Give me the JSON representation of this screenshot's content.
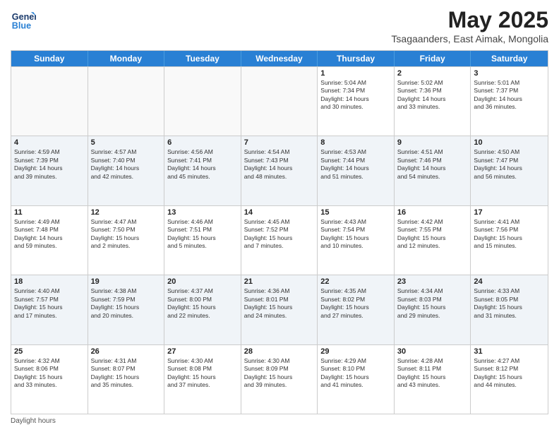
{
  "header": {
    "logo_general": "General",
    "logo_blue": "Blue",
    "month_title": "May 2025",
    "location": "Tsagaanders, East Aimak, Mongolia"
  },
  "days_of_week": [
    "Sunday",
    "Monday",
    "Tuesday",
    "Wednesday",
    "Thursday",
    "Friday",
    "Saturday"
  ],
  "footer": {
    "note": "Daylight hours"
  },
  "weeks": [
    [
      {
        "day": "",
        "info": ""
      },
      {
        "day": "",
        "info": ""
      },
      {
        "day": "",
        "info": ""
      },
      {
        "day": "",
        "info": ""
      },
      {
        "day": "1",
        "info": "Sunrise: 5:04 AM\nSunset: 7:34 PM\nDaylight: 14 hours\nand 30 minutes."
      },
      {
        "day": "2",
        "info": "Sunrise: 5:02 AM\nSunset: 7:36 PM\nDaylight: 14 hours\nand 33 minutes."
      },
      {
        "day": "3",
        "info": "Sunrise: 5:01 AM\nSunset: 7:37 PM\nDaylight: 14 hours\nand 36 minutes."
      }
    ],
    [
      {
        "day": "4",
        "info": "Sunrise: 4:59 AM\nSunset: 7:39 PM\nDaylight: 14 hours\nand 39 minutes."
      },
      {
        "day": "5",
        "info": "Sunrise: 4:57 AM\nSunset: 7:40 PM\nDaylight: 14 hours\nand 42 minutes."
      },
      {
        "day": "6",
        "info": "Sunrise: 4:56 AM\nSunset: 7:41 PM\nDaylight: 14 hours\nand 45 minutes."
      },
      {
        "day": "7",
        "info": "Sunrise: 4:54 AM\nSunset: 7:43 PM\nDaylight: 14 hours\nand 48 minutes."
      },
      {
        "day": "8",
        "info": "Sunrise: 4:53 AM\nSunset: 7:44 PM\nDaylight: 14 hours\nand 51 minutes."
      },
      {
        "day": "9",
        "info": "Sunrise: 4:51 AM\nSunset: 7:46 PM\nDaylight: 14 hours\nand 54 minutes."
      },
      {
        "day": "10",
        "info": "Sunrise: 4:50 AM\nSunset: 7:47 PM\nDaylight: 14 hours\nand 56 minutes."
      }
    ],
    [
      {
        "day": "11",
        "info": "Sunrise: 4:49 AM\nSunset: 7:48 PM\nDaylight: 14 hours\nand 59 minutes."
      },
      {
        "day": "12",
        "info": "Sunrise: 4:47 AM\nSunset: 7:50 PM\nDaylight: 15 hours\nand 2 minutes."
      },
      {
        "day": "13",
        "info": "Sunrise: 4:46 AM\nSunset: 7:51 PM\nDaylight: 15 hours\nand 5 minutes."
      },
      {
        "day": "14",
        "info": "Sunrise: 4:45 AM\nSunset: 7:52 PM\nDaylight: 15 hours\nand 7 minutes."
      },
      {
        "day": "15",
        "info": "Sunrise: 4:43 AM\nSunset: 7:54 PM\nDaylight: 15 hours\nand 10 minutes."
      },
      {
        "day": "16",
        "info": "Sunrise: 4:42 AM\nSunset: 7:55 PM\nDaylight: 15 hours\nand 12 minutes."
      },
      {
        "day": "17",
        "info": "Sunrise: 4:41 AM\nSunset: 7:56 PM\nDaylight: 15 hours\nand 15 minutes."
      }
    ],
    [
      {
        "day": "18",
        "info": "Sunrise: 4:40 AM\nSunset: 7:57 PM\nDaylight: 15 hours\nand 17 minutes."
      },
      {
        "day": "19",
        "info": "Sunrise: 4:38 AM\nSunset: 7:59 PM\nDaylight: 15 hours\nand 20 minutes."
      },
      {
        "day": "20",
        "info": "Sunrise: 4:37 AM\nSunset: 8:00 PM\nDaylight: 15 hours\nand 22 minutes."
      },
      {
        "day": "21",
        "info": "Sunrise: 4:36 AM\nSunset: 8:01 PM\nDaylight: 15 hours\nand 24 minutes."
      },
      {
        "day": "22",
        "info": "Sunrise: 4:35 AM\nSunset: 8:02 PM\nDaylight: 15 hours\nand 27 minutes."
      },
      {
        "day": "23",
        "info": "Sunrise: 4:34 AM\nSunset: 8:03 PM\nDaylight: 15 hours\nand 29 minutes."
      },
      {
        "day": "24",
        "info": "Sunrise: 4:33 AM\nSunset: 8:05 PM\nDaylight: 15 hours\nand 31 minutes."
      }
    ],
    [
      {
        "day": "25",
        "info": "Sunrise: 4:32 AM\nSunset: 8:06 PM\nDaylight: 15 hours\nand 33 minutes."
      },
      {
        "day": "26",
        "info": "Sunrise: 4:31 AM\nSunset: 8:07 PM\nDaylight: 15 hours\nand 35 minutes."
      },
      {
        "day": "27",
        "info": "Sunrise: 4:30 AM\nSunset: 8:08 PM\nDaylight: 15 hours\nand 37 minutes."
      },
      {
        "day": "28",
        "info": "Sunrise: 4:30 AM\nSunset: 8:09 PM\nDaylight: 15 hours\nand 39 minutes."
      },
      {
        "day": "29",
        "info": "Sunrise: 4:29 AM\nSunset: 8:10 PM\nDaylight: 15 hours\nand 41 minutes."
      },
      {
        "day": "30",
        "info": "Sunrise: 4:28 AM\nSunset: 8:11 PM\nDaylight: 15 hours\nand 43 minutes."
      },
      {
        "day": "31",
        "info": "Sunrise: 4:27 AM\nSunset: 8:12 PM\nDaylight: 15 hours\nand 44 minutes."
      }
    ]
  ]
}
